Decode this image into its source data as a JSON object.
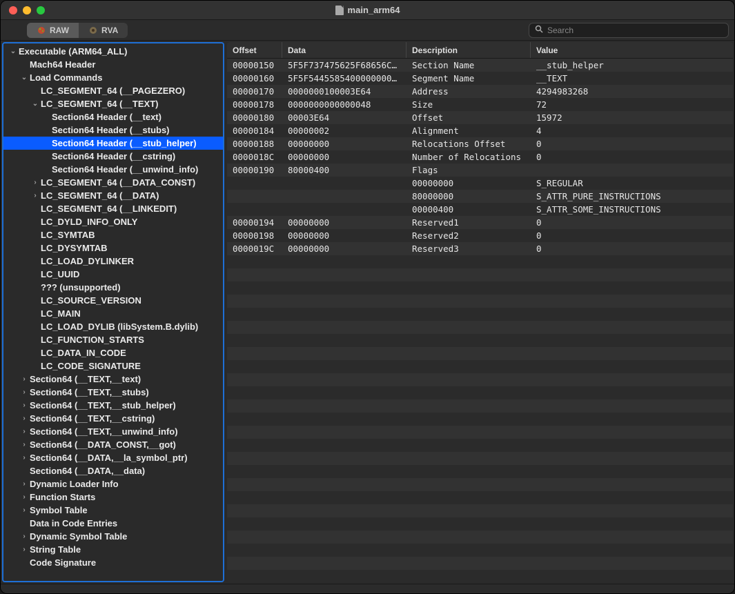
{
  "window": {
    "title": "main_arm64"
  },
  "toolbar": {
    "raw_label": "RAW",
    "rva_label": "RVA",
    "search_placeholder": "Search"
  },
  "sidebar": {
    "items": [
      {
        "label": "Executable  (ARM64_ALL)",
        "indent": 0,
        "arrow": "down"
      },
      {
        "label": "Mach64 Header",
        "indent": 1,
        "arrow": ""
      },
      {
        "label": "Load Commands",
        "indent": 1,
        "arrow": "down"
      },
      {
        "label": "LC_SEGMENT_64 (__PAGEZERO)",
        "indent": 2,
        "arrow": ""
      },
      {
        "label": "LC_SEGMENT_64 (__TEXT)",
        "indent": 2,
        "arrow": "down"
      },
      {
        "label": "Section64 Header (__text)",
        "indent": 3,
        "arrow": ""
      },
      {
        "label": "Section64 Header (__stubs)",
        "indent": 3,
        "arrow": ""
      },
      {
        "label": "Section64 Header (__stub_helper)",
        "indent": 3,
        "arrow": "",
        "selected": true
      },
      {
        "label": "Section64 Header (__cstring)",
        "indent": 3,
        "arrow": ""
      },
      {
        "label": "Section64 Header (__unwind_info)",
        "indent": 3,
        "arrow": ""
      },
      {
        "label": "LC_SEGMENT_64 (__DATA_CONST)",
        "indent": 2,
        "arrow": "right"
      },
      {
        "label": "LC_SEGMENT_64 (__DATA)",
        "indent": 2,
        "arrow": "right"
      },
      {
        "label": "LC_SEGMENT_64 (__LINKEDIT)",
        "indent": 2,
        "arrow": ""
      },
      {
        "label": "LC_DYLD_INFO_ONLY",
        "indent": 2,
        "arrow": ""
      },
      {
        "label": "LC_SYMTAB",
        "indent": 2,
        "arrow": ""
      },
      {
        "label": "LC_DYSYMTAB",
        "indent": 2,
        "arrow": ""
      },
      {
        "label": "LC_LOAD_DYLINKER",
        "indent": 2,
        "arrow": ""
      },
      {
        "label": "LC_UUID",
        "indent": 2,
        "arrow": ""
      },
      {
        "label": "??? (unsupported)",
        "indent": 2,
        "arrow": ""
      },
      {
        "label": "LC_SOURCE_VERSION",
        "indent": 2,
        "arrow": ""
      },
      {
        "label": "LC_MAIN",
        "indent": 2,
        "arrow": ""
      },
      {
        "label": "LC_LOAD_DYLIB (libSystem.B.dylib)",
        "indent": 2,
        "arrow": ""
      },
      {
        "label": "LC_FUNCTION_STARTS",
        "indent": 2,
        "arrow": ""
      },
      {
        "label": "LC_DATA_IN_CODE",
        "indent": 2,
        "arrow": ""
      },
      {
        "label": "LC_CODE_SIGNATURE",
        "indent": 2,
        "arrow": ""
      },
      {
        "label": "Section64 (__TEXT,__text)",
        "indent": 1,
        "arrow": "right"
      },
      {
        "label": "Section64 (__TEXT,__stubs)",
        "indent": 1,
        "arrow": "right"
      },
      {
        "label": "Section64 (__TEXT,__stub_helper)",
        "indent": 1,
        "arrow": "right"
      },
      {
        "label": "Section64 (__TEXT,__cstring)",
        "indent": 1,
        "arrow": "right"
      },
      {
        "label": "Section64 (__TEXT,__unwind_info)",
        "indent": 1,
        "arrow": "right"
      },
      {
        "label": "Section64 (__DATA_CONST,__got)",
        "indent": 1,
        "arrow": "right"
      },
      {
        "label": "Section64 (__DATA,__la_symbol_ptr)",
        "indent": 1,
        "arrow": "right"
      },
      {
        "label": "Section64 (__DATA,__data)",
        "indent": 1,
        "arrow": ""
      },
      {
        "label": "Dynamic Loader Info",
        "indent": 1,
        "arrow": "right"
      },
      {
        "label": "Function Starts",
        "indent": 1,
        "arrow": "right"
      },
      {
        "label": "Symbol Table",
        "indent": 1,
        "arrow": "right"
      },
      {
        "label": "Data in Code Entries",
        "indent": 1,
        "arrow": ""
      },
      {
        "label": "Dynamic Symbol Table",
        "indent": 1,
        "arrow": "right"
      },
      {
        "label": "String Table",
        "indent": 1,
        "arrow": "right"
      },
      {
        "label": "Code Signature",
        "indent": 1,
        "arrow": ""
      }
    ]
  },
  "table": {
    "headers": {
      "offset": "Offset",
      "data": "Data",
      "description": "Description",
      "value": "Value"
    },
    "rows": [
      {
        "offset": "00000150",
        "data": "5F5F737475625F68656C706…",
        "desc": "Section Name",
        "value": "__stub_helper"
      },
      {
        "offset": "00000160",
        "data": "5F5F5445585400000000000…",
        "desc": "Segment Name",
        "value": "__TEXT"
      },
      {
        "offset": "00000170",
        "data": "0000000100003E64",
        "desc": "Address",
        "value": "4294983268"
      },
      {
        "offset": "00000178",
        "data": "0000000000000048",
        "desc": "Size",
        "value": "72"
      },
      {
        "offset": "00000180",
        "data": "00003E64",
        "desc": "Offset",
        "value": "15972"
      },
      {
        "offset": "00000184",
        "data": "00000002",
        "desc": "Alignment",
        "value": "4"
      },
      {
        "offset": "00000188",
        "data": "00000000",
        "desc": "Relocations Offset",
        "value": "0"
      },
      {
        "offset": "0000018C",
        "data": "00000000",
        "desc": "Number of Relocations",
        "value": "0"
      },
      {
        "offset": "00000190",
        "data": "80000400",
        "desc": "Flags",
        "value": ""
      },
      {
        "offset": "",
        "data": "",
        "desc": "00000000",
        "value": "S_REGULAR"
      },
      {
        "offset": "",
        "data": "",
        "desc": "80000000",
        "value": "S_ATTR_PURE_INSTRUCTIONS"
      },
      {
        "offset": "",
        "data": "",
        "desc": "00000400",
        "value": "S_ATTR_SOME_INSTRUCTIONS"
      },
      {
        "offset": "00000194",
        "data": "00000000",
        "desc": "Reserved1",
        "value": "0"
      },
      {
        "offset": "00000198",
        "data": "00000000",
        "desc": "Reserved2",
        "value": "0"
      },
      {
        "offset": "0000019C",
        "data": "00000000",
        "desc": "Reserved3",
        "value": "0"
      }
    ],
    "blank_rows": 25
  }
}
